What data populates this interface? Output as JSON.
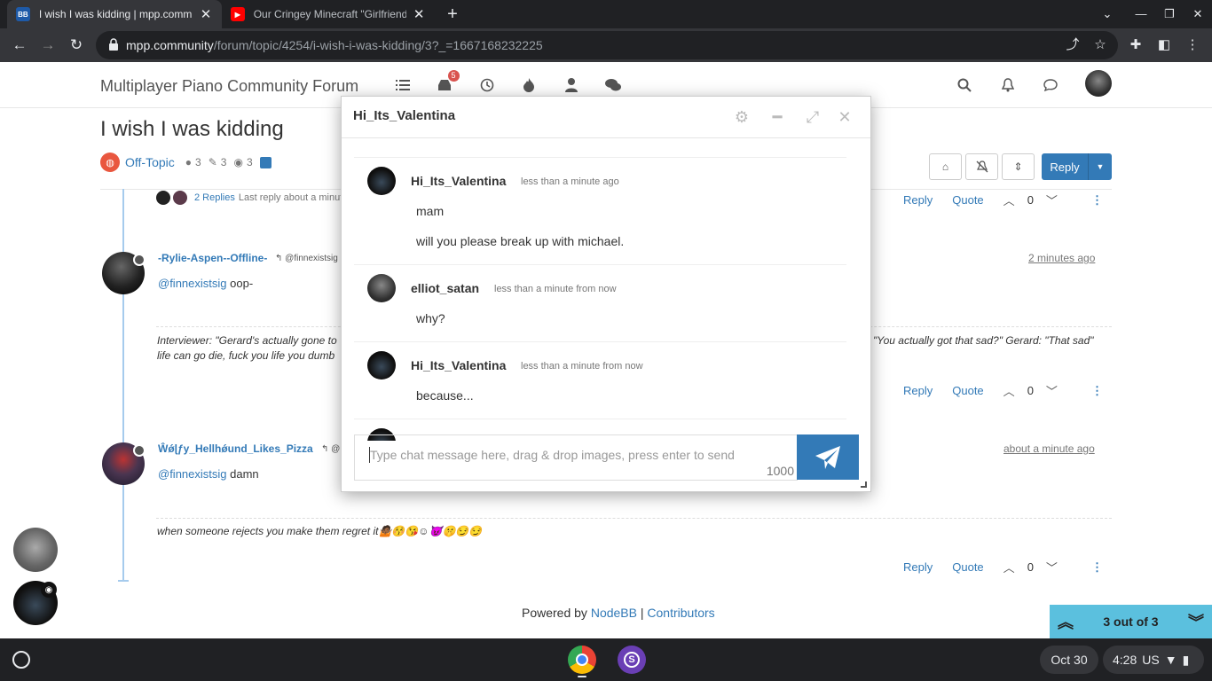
{
  "browser": {
    "tabs": [
      {
        "title": "I wish I was kidding | mpp.comm",
        "favicon": "nodebb-icon",
        "active": true
      },
      {
        "title": "Our Cringey Minecraft \"Girlfriend",
        "favicon": "youtube-icon",
        "active": false
      }
    ],
    "url_host": "mpp.community",
    "url_path": "/forum/topic/4254/i-wish-i-was-kidding/3?_=1667168232225"
  },
  "forum": {
    "brand": "Multiplayer Piano Community Forum",
    "notification_count": "5",
    "topic_title": "I wish I was kidding",
    "category": "Off-Topic",
    "stats": {
      "posters": "3",
      "posts": "3",
      "views": "3"
    },
    "reply_label": "Reply",
    "replies_link": "2 Replies",
    "replies_last": "Last reply about a minute",
    "actions": {
      "reply": "Reply",
      "quote": "Quote"
    },
    "posts": [
      {
        "user": "-Rylie-Aspen--Offline-",
        "reply_to": "@finnexistsig",
        "time": "2 minutes ago",
        "mention": "@finnexistsig",
        "text": " oop-",
        "votes": "0",
        "signature_left": "Interviewer: \"Gerard's actually gone to",
        "signature_left2": "life can go die, fuck you life you dumb",
        "signature_right": "\"You actually got that sad?\" Gerard: \"That sad\""
      },
      {
        "user": "Ŵǿɭƒy_Hellhǿund_Likes_Pizza",
        "reply_to": "@",
        "time": "about a minute ago",
        "mention": "@finnexistsig",
        "text": " damn",
        "votes": "0",
        "signature": "when someone rejects you make them regret it🤷🏾😚😘☺😈🤫😏😏"
      }
    ],
    "first_votes": "0",
    "powered_by": "Powered by ",
    "nodebb": "NodeBB",
    "pipe": " | ",
    "contributors": "Contributors",
    "pagination": "3 out of 3"
  },
  "chat": {
    "title": "Hi_Its_Valentina",
    "messages": [
      {
        "user": "Hi_Its_Valentina",
        "time": "less than a minute ago",
        "lines": [
          "mam",
          "will you please break up with michael."
        ]
      },
      {
        "user": "elliot_satan",
        "time": "less than a minute from now",
        "lines": [
          "why?"
        ]
      },
      {
        "user": "Hi_Its_Valentina",
        "time": "less than a minute from now",
        "lines": [
          "because..."
        ]
      }
    ],
    "placeholder": "Type chat message here, drag & drop images, press enter to send",
    "char_count": "1000"
  },
  "shelf": {
    "date": "Oct 30",
    "time": "4:28",
    "locale": "US"
  },
  "colors": {
    "link": "#337ab7",
    "category": "#e9573f",
    "pagination": "#5bc0de",
    "chrome_dark": "#202124"
  }
}
